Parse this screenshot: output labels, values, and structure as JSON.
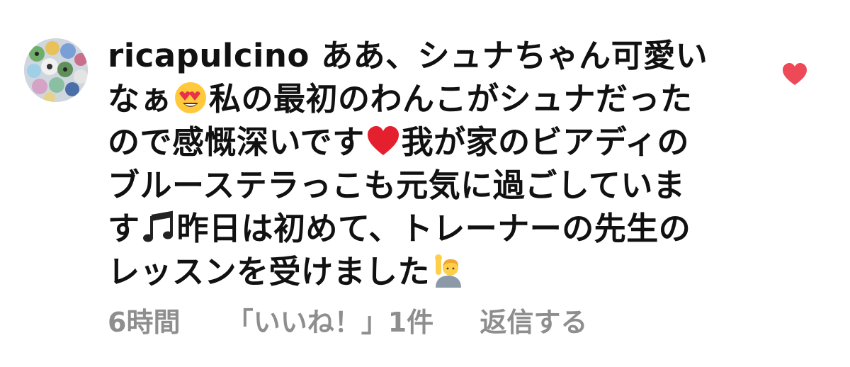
{
  "comment": {
    "username": "ricapulcino",
    "lines": [
      {
        "text_a": "ああ、シュナちゃん可愛い"
      },
      {
        "text_a": "なぁ",
        "text_b": "私の最初のわんこがシュナだった"
      },
      {
        "text_a": "ので感慨深いです",
        "text_b": "我が家のビアディの"
      },
      {
        "text_a": "ブルーステラっこも元気に過ごしていま"
      },
      {
        "text_a": "す",
        "text_b": "昨日は初めて、トレーナーの先生の"
      },
      {
        "text_a": "レッスンを受けました"
      }
    ],
    "emojis": {
      "heart_eyes": "smiling-face-with-heart-eyes-icon",
      "red_heart": "red-heart-icon",
      "music_notes": "musical-notes-icon",
      "raising_hand": "person-raising-hand-icon"
    }
  },
  "meta": {
    "time": "6時間",
    "likes": "「いいね！」1件",
    "reply": "返信する"
  },
  "like_button": {
    "icon": "heart-icon",
    "liked": true,
    "color": "#ed4956"
  },
  "colors": {
    "text": "#111111",
    "meta_text": "#8e8e8e",
    "like": "#ed4956"
  }
}
